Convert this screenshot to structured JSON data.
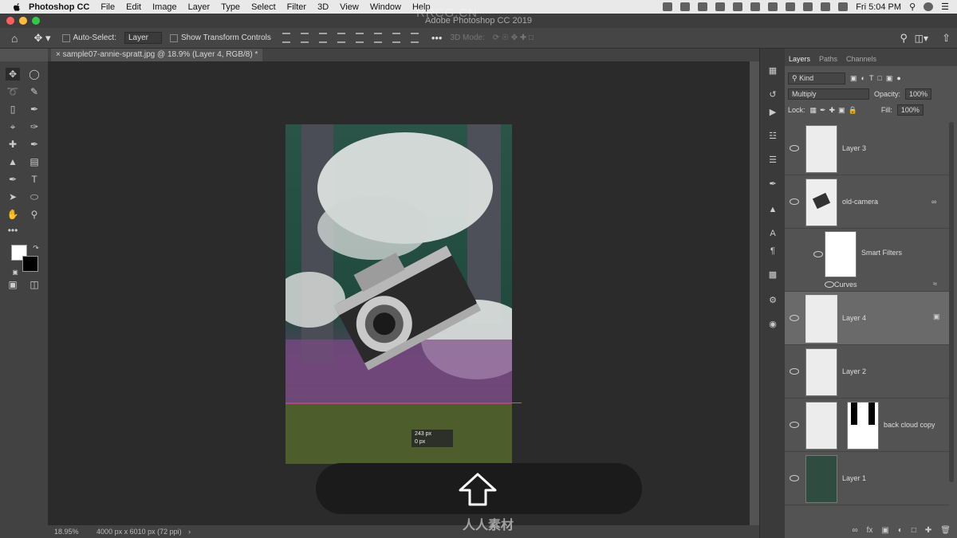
{
  "menubar": {
    "app_name": "Photoshop CC",
    "items": [
      "File",
      "Edit",
      "Image",
      "Layer",
      "Type",
      "Select",
      "Filter",
      "3D",
      "View",
      "Window",
      "Help"
    ],
    "clock": "Fri 5:04 PM"
  },
  "titlebar": {
    "title": "Adobe Photoshop CC 2019"
  },
  "options": {
    "auto_select_label": "Auto-Select:",
    "auto_select_value": "Layer",
    "show_transform_label": "Show Transform Controls",
    "mode_3d_label": "3D Mode:"
  },
  "document": {
    "tab_title": "sample07-annie-spratt.jpg @ 18.9% (Layer 4, RGB/8) *",
    "measure_x": "243 px",
    "measure_y": "0 px"
  },
  "status": {
    "zoom": "18.95%",
    "doc_info": "4000 px x 6010 px (72 ppi)"
  },
  "layers_panel": {
    "tabs": [
      "Layers",
      "Paths",
      "Channels"
    ],
    "kind_label": "Kind",
    "blend_mode": "Multiply",
    "opacity_label": "Opacity:",
    "opacity_value": "100%",
    "lock_label": "Lock:",
    "fill_label": "Fill:",
    "fill_value": "100%",
    "layers": [
      {
        "name": "Layer 3"
      },
      {
        "name": "old-camera"
      },
      {
        "name": "Smart Filters"
      },
      {
        "name": "Curves"
      },
      {
        "name": "Layer 4"
      },
      {
        "name": "Layer 2"
      },
      {
        "name": "back cloud copy"
      },
      {
        "name": "Layer 1"
      }
    ],
    "footer_fx": "fx"
  },
  "watermark": {
    "brand": "RRCG.CN",
    "site_cn": "人人素材"
  }
}
